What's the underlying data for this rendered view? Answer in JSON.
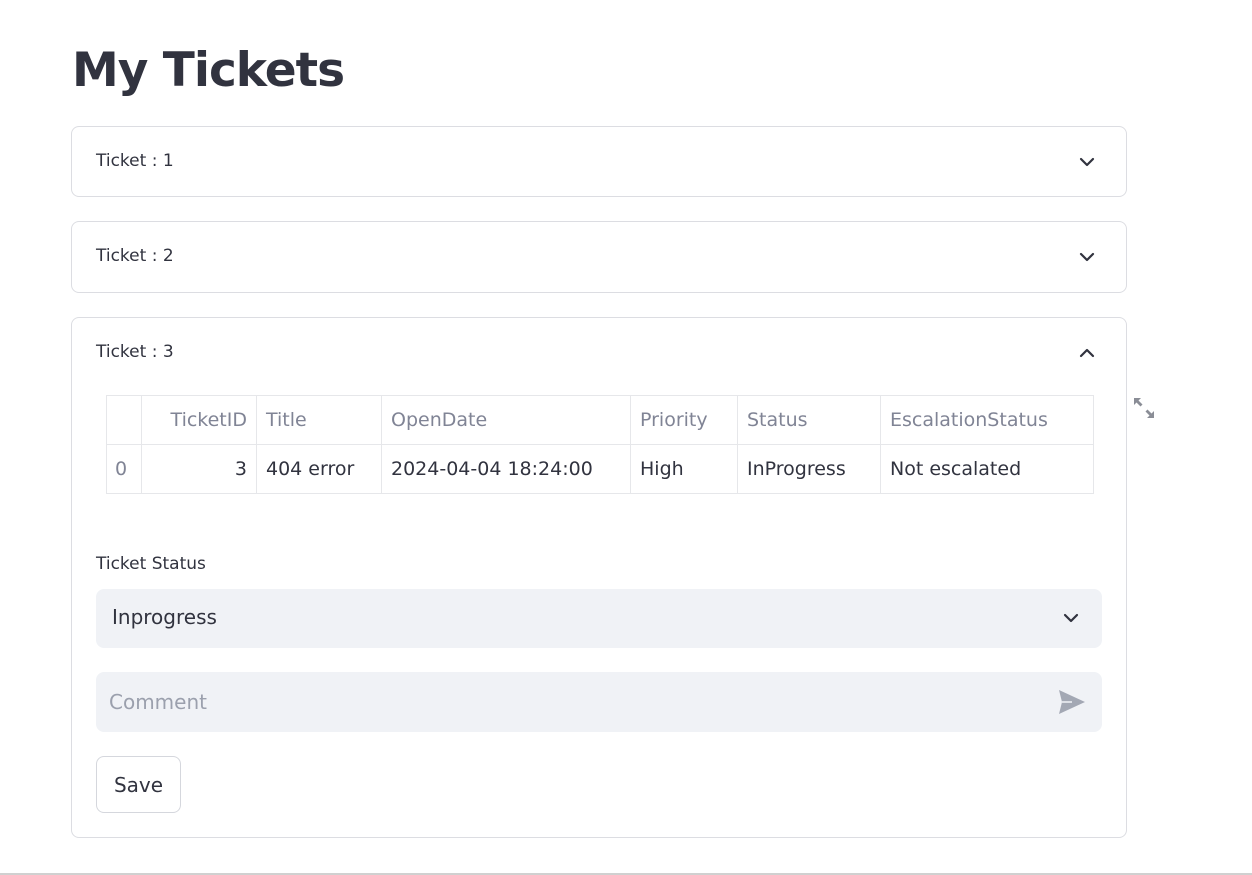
{
  "page_title": "My Tickets",
  "expanders": [
    {
      "label": "Ticket : 1",
      "expanded": false
    },
    {
      "label": "Ticket : 2",
      "expanded": false
    },
    {
      "label": "Ticket : 3",
      "expanded": true
    }
  ],
  "ticket_table": {
    "columns": [
      "",
      "TicketID",
      "Title",
      "OpenDate",
      "Priority",
      "Status",
      "EscalationStatus"
    ],
    "rows": [
      [
        "0",
        "3",
        "404 error",
        "2024-04-04 18:24:00",
        "High",
        "InProgress",
        "Not escalated"
      ]
    ]
  },
  "status_field": {
    "label": "Ticket Status",
    "selected": "Inprogress"
  },
  "comment_field": {
    "placeholder": "Comment",
    "value": ""
  },
  "save_label": "Save",
  "icons": {
    "expand_closed": "chevron-down-icon",
    "expand_open": "chevron-up-icon",
    "select": "chevron-down-icon",
    "submit": "send-icon",
    "fullscreen": "fullscreen-icon"
  }
}
